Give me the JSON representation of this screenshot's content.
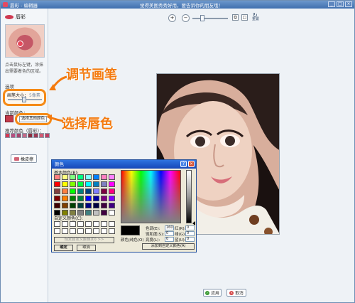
{
  "window": {
    "title": "唇彩 - 编辑器",
    "banner": "觉得美图秀秀好用，要告诉你的朋友哦！",
    "controls": [
      "_",
      "□",
      "×"
    ]
  },
  "sidebar": {
    "effect_name": "唇彩",
    "hint": "点击鼠标左键，涂抹出需要着色的区域。",
    "options_label": "选项",
    "brush_size_label": "画笔大小：",
    "brush_size_value": "5像素",
    "slider_level": 0.5,
    "lip_color_label": "当前颜色：",
    "pick_other_color": "选择其他颜色",
    "recommended_label": "推荐颜色（唇彩）：",
    "eraser": "橡皮擦",
    "recommended_colors": [
      "#d43a55",
      "#b84f7f",
      "#a7466d",
      "#c46a88",
      "#8b2d3e",
      "#9b3a54",
      "#d15b73",
      "#be3f63"
    ]
  },
  "annotations": {
    "adjust_brush": "调节画笔",
    "choose_lip_color": "选择唇色"
  },
  "toolbar": {
    "zoom_in": "+",
    "zoom_out": "−",
    "tool_a": "⧉",
    "tool_b": "□",
    "reset": "重置"
  },
  "dialog": {
    "title": "颜色",
    "help": "?",
    "close": "×",
    "basic_colors_label": "基本颜色(B):",
    "custom_colors_label": "自定义颜色(C):",
    "define_custom": "规定自定义颜色(D) >>",
    "ok": "确定",
    "cancel": "取消",
    "color_solid_label": "颜色|纯色(O)",
    "add_custom": "添加到自定义颜色(A)",
    "fields": [
      {
        "label": "色调(E):",
        "value": "160"
      },
      {
        "label": "红(R):",
        "value": "0"
      },
      {
        "label": "饱和度(S):",
        "value": "0"
      },
      {
        "label": "绿(G):",
        "value": "0"
      },
      {
        "label": "亮度(L):",
        "value": "0"
      },
      {
        "label": "蓝(U):",
        "value": "0"
      }
    ],
    "basic_colors": [
      "#ff8080",
      "#ffff80",
      "#80ff80",
      "#00ff80",
      "#80ffff",
      "#0080ff",
      "#ff80c0",
      "#ff80ff",
      "#ff0000",
      "#ffff00",
      "#80ff00",
      "#00ff40",
      "#00ffff",
      "#0080c0",
      "#8080c0",
      "#ff00ff",
      "#804040",
      "#ff8040",
      "#00ff00",
      "#008080",
      "#004080",
      "#8080ff",
      "#800040",
      "#ff0080",
      "#800000",
      "#ff8000",
      "#008000",
      "#008040",
      "#0000ff",
      "#0000a0",
      "#800080",
      "#8000ff",
      "#400000",
      "#804000",
      "#004000",
      "#004040",
      "#000080",
      "#000040",
      "#400040",
      "#400080",
      "#000000",
      "#808000",
      "#808040",
      "#808080",
      "#408080",
      "#c0c0c0",
      "#400040",
      "#ffffff"
    ],
    "custom_colors": [
      "#ffffff",
      "#ffffff",
      "#ffffff",
      "#ffffff",
      "#ffffff",
      "#ffffff",
      "#ffffff",
      "#ffffff",
      "#ffffff",
      "#ffffff",
      "#ffffff",
      "#ffffff",
      "#ffffff",
      "#ffffff",
      "#ffffff",
      "#ffffff"
    ]
  },
  "footer": {
    "apply": "应用",
    "cancel": "取消"
  }
}
